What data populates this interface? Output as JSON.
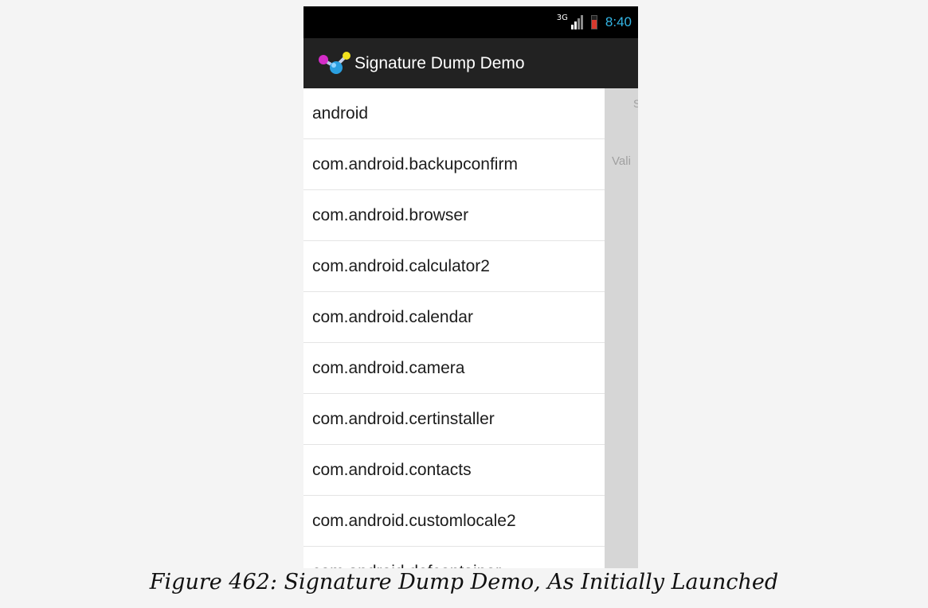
{
  "status_bar": {
    "network_type": "3G",
    "time": "8:40",
    "time_color": "#33b5e5",
    "icons": [
      "signal-icon",
      "battery-icon"
    ]
  },
  "action_bar": {
    "title": "Signature Dump Demo",
    "icon": "app-icon"
  },
  "package_list": [
    "android",
    "com.android.backupconfirm",
    "com.android.browser",
    "com.android.calculator2",
    "com.android.calendar",
    "com.android.camera",
    "com.android.certinstaller",
    "com.android.contacts",
    "com.android.customlocale2",
    "com.android.defcontainer"
  ],
  "detail_pane": {
    "subject_fragment": "S",
    "valid_fragment": "Vali"
  },
  "caption": "Figure 462: Signature Dump Demo, As Initially Launched"
}
